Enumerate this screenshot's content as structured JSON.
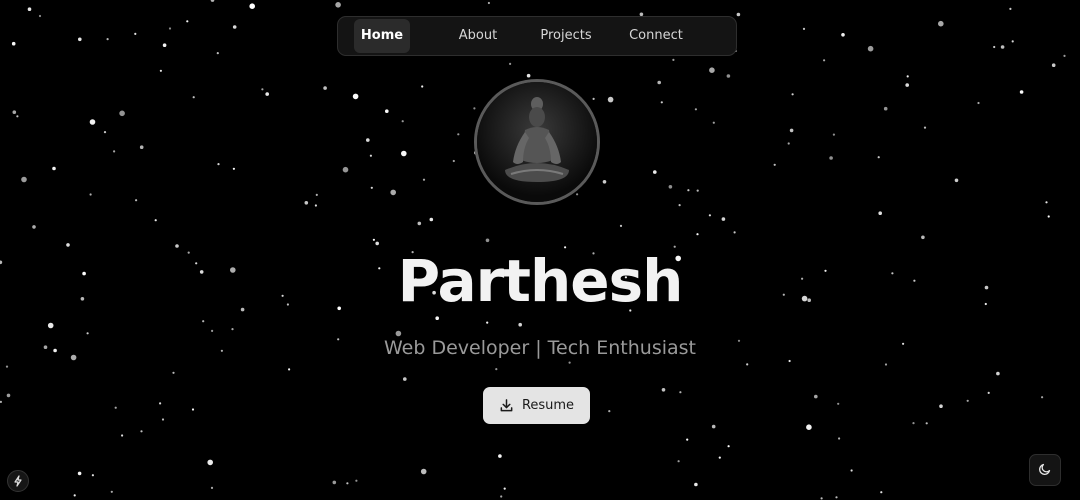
{
  "nav": {
    "items": [
      {
        "label": "Home",
        "active": true
      },
      {
        "label": "About",
        "active": false
      },
      {
        "label": "Projects",
        "active": false
      },
      {
        "label": "Connect",
        "active": false
      }
    ]
  },
  "hero": {
    "name": "Parthesh",
    "subtitle": "Web Developer | Tech Enthusiast",
    "resume_label": "Resume",
    "resume_icon": "download-icon",
    "avatar_icon": "meditating-figure-avatar"
  },
  "controls": {
    "bolt_icon": "bolt-icon",
    "theme_icon": "moon-icon"
  },
  "colors": {
    "background": "#000000",
    "star": "#ffffff",
    "button_bg": "#e4e4e4",
    "nav_active_bg": "#2b2b2b"
  }
}
